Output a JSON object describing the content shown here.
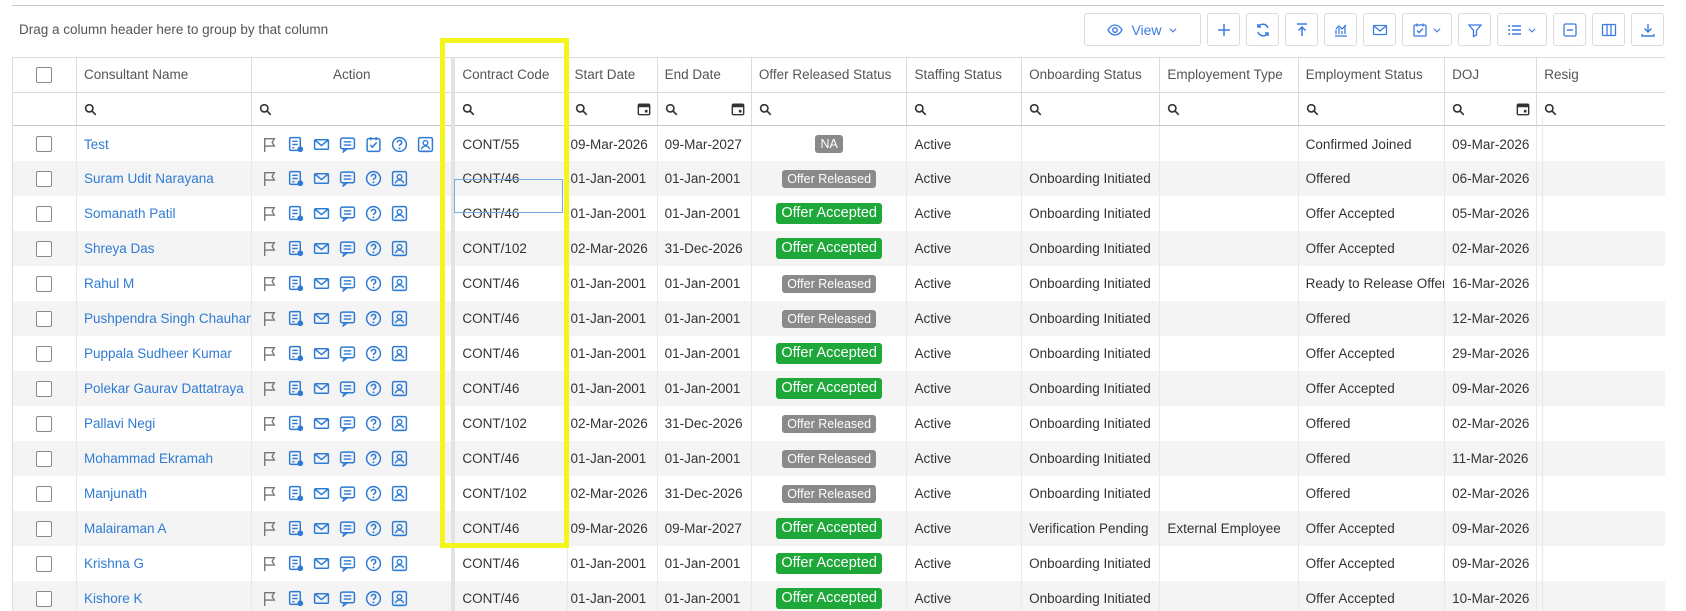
{
  "group_hint": "Drag a column header here to group by that column",
  "toolbar": {
    "view_label": "View",
    "icons": [
      "eye-icon",
      "plus-icon",
      "refresh-icon",
      "upload-icon",
      "chart-icon",
      "mail-icon",
      "checklist-icon",
      "filter-icon",
      "list-icon",
      "collapse-icon",
      "columns-icon",
      "download-icon"
    ]
  },
  "columns": [
    "",
    "Consultant Name",
    "Action",
    "Contract Code",
    "Start Date",
    "End Date",
    "Offer Released Status",
    "Staffing Status",
    "Onboarding Status",
    "Employement Type",
    "Employment Status",
    "DOJ",
    "Resig"
  ],
  "action_icons": [
    "flag-icon",
    "document-icon",
    "mail-icon",
    "message-icon",
    "check-icon",
    "help-icon",
    "profile-icon"
  ],
  "rows": [
    {
      "name": "Test",
      "code": "CONT/55",
      "start": "09-Mar-2026",
      "end": "09-Mar-2027",
      "offer": "NA",
      "offer_style": "na",
      "staffing": "Active",
      "onboarding": "",
      "emp_type": "",
      "emp_status": "Confirmed Joined",
      "doj": "09-Mar-2026",
      "extra_check": true
    },
    {
      "name": "Suram Udit Narayana",
      "code": "CONT/46",
      "start": "01-Jan-2001",
      "end": "01-Jan-2001",
      "offer": "Offer Released",
      "offer_style": "rel",
      "staffing": "Active",
      "onboarding": "Onboarding Initiated",
      "emp_type": "",
      "emp_status": "Offered",
      "doj": "06-Mar-2026",
      "extra_check": false
    },
    {
      "name": "Somanath Patil",
      "code": "CONT/46",
      "start": "01-Jan-2001",
      "end": "01-Jan-2001",
      "offer": "Offer Accepted",
      "offer_style": "acc",
      "staffing": "Active",
      "onboarding": "Onboarding Initiated",
      "emp_type": "",
      "emp_status": "Offer Accepted",
      "doj": "05-Mar-2026",
      "extra_check": false
    },
    {
      "name": "Shreya Das",
      "code": "CONT/102",
      "start": "02-Mar-2026",
      "end": "31-Dec-2026",
      "offer": "Offer Accepted",
      "offer_style": "acc",
      "staffing": "Active",
      "onboarding": "Onboarding Initiated",
      "emp_type": "",
      "emp_status": "Offer Accepted",
      "doj": "02-Mar-2026",
      "extra_check": false
    },
    {
      "name": "Rahul M",
      "code": "CONT/46",
      "start": "01-Jan-2001",
      "end": "01-Jan-2001",
      "offer": "Offer Released",
      "offer_style": "rel",
      "staffing": "Active",
      "onboarding": "Onboarding Initiated",
      "emp_type": "",
      "emp_status": "Ready to Release Offer",
      "doj": "16-Mar-2026",
      "extra_check": false
    },
    {
      "name": "Pushpendra Singh Chauhan",
      "code": "CONT/46",
      "start": "01-Jan-2001",
      "end": "01-Jan-2001",
      "offer": "Offer Released",
      "offer_style": "rel",
      "staffing": "Active",
      "onboarding": "Onboarding Initiated",
      "emp_type": "",
      "emp_status": "Offered",
      "doj": "12-Mar-2026",
      "extra_check": false
    },
    {
      "name": "Puppala Sudheer Kumar",
      "code": "CONT/46",
      "start": "01-Jan-2001",
      "end": "01-Jan-2001",
      "offer": "Offer Accepted",
      "offer_style": "acc",
      "staffing": "Active",
      "onboarding": "Onboarding Initiated",
      "emp_type": "",
      "emp_status": "Offer Accepted",
      "doj": "29-Mar-2026",
      "extra_check": false
    },
    {
      "name": "Polekar Gaurav Dattatraya",
      "code": "CONT/46",
      "start": "01-Jan-2001",
      "end": "01-Jan-2001",
      "offer": "Offer Accepted",
      "offer_style": "acc",
      "staffing": "Active",
      "onboarding": "Onboarding Initiated",
      "emp_type": "",
      "emp_status": "Offer Accepted",
      "doj": "09-Mar-2026",
      "extra_check": false
    },
    {
      "name": "Pallavi Negi",
      "code": "CONT/102",
      "start": "02-Mar-2026",
      "end": "31-Dec-2026",
      "offer": "Offer Released",
      "offer_style": "rel",
      "staffing": "Active",
      "onboarding": "Onboarding Initiated",
      "emp_type": "",
      "emp_status": "Offered",
      "doj": "02-Mar-2026",
      "extra_check": false
    },
    {
      "name": "Mohammad Ekramah",
      "code": "CONT/46",
      "start": "01-Jan-2001",
      "end": "01-Jan-2001",
      "offer": "Offer Released",
      "offer_style": "rel",
      "staffing": "Active",
      "onboarding": "Onboarding Initiated",
      "emp_type": "",
      "emp_status": "Offered",
      "doj": "11-Mar-2026",
      "extra_check": false
    },
    {
      "name": "Manjunath",
      "code": "CONT/102",
      "start": "02-Mar-2026",
      "end": "31-Dec-2026",
      "offer": "Offer Released",
      "offer_style": "rel",
      "staffing": "Active",
      "onboarding": "Onboarding Initiated",
      "emp_type": "",
      "emp_status": "Offered",
      "doj": "02-Mar-2026",
      "extra_check": false
    },
    {
      "name": "Malairaman A",
      "code": "CONT/46",
      "start": "09-Mar-2026",
      "end": "09-Mar-2027",
      "offer": "Offer Accepted",
      "offer_style": "acc",
      "staffing": "Active",
      "onboarding": "Verification Pending",
      "emp_type": "External Employee",
      "emp_status": "Offer Accepted",
      "doj": "09-Mar-2026",
      "extra_check": false
    },
    {
      "name": "Krishna G",
      "code": "CONT/46",
      "start": "01-Jan-2001",
      "end": "01-Jan-2001",
      "offer": "Offer Accepted",
      "offer_style": "acc",
      "staffing": "Active",
      "onboarding": "Onboarding Initiated",
      "emp_type": "",
      "emp_status": "Offer Accepted",
      "doj": "09-Mar-2026",
      "extra_check": false
    },
    {
      "name": "Kishore K",
      "code": "CONT/46",
      "start": "01-Jan-2001",
      "end": "01-Jan-2001",
      "offer": "Offer Accepted",
      "offer_style": "acc",
      "staffing": "Active",
      "onboarding": "Onboarding Initiated",
      "emp_type": "",
      "emp_status": "Offer Accepted",
      "doj": "10-Mar-2026",
      "extra_check": false
    }
  ]
}
